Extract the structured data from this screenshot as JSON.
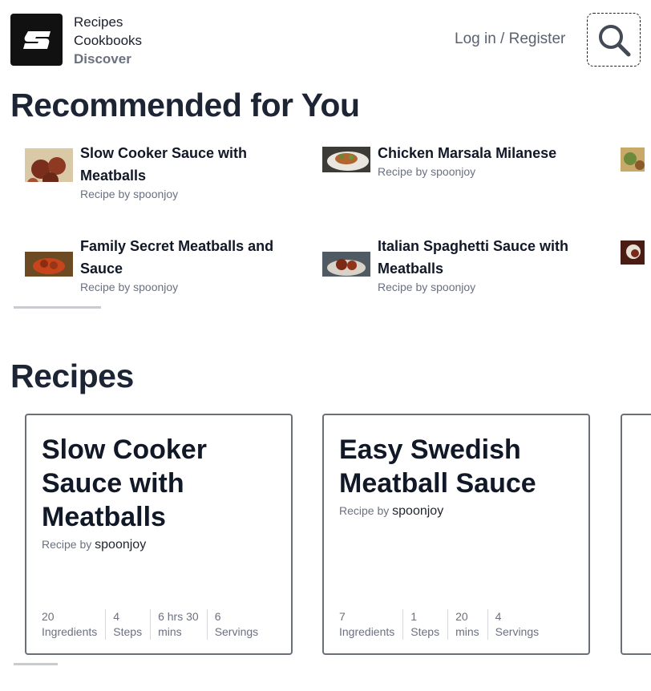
{
  "header": {
    "nav": [
      "Recipes",
      "Cookbooks",
      "Discover"
    ],
    "login_label": "Log in / Register",
    "search_icon": "search-icon"
  },
  "recommended": {
    "title": "Recommended for You",
    "items": [
      {
        "name": "Slow Cooker Sauce with Meatballs",
        "byline": "Recipe by spoonjoy"
      },
      {
        "name": "Chicken Marsala Milanese",
        "byline": "Recipe by spoonjoy"
      },
      {
        "name": "Family Secret Meatballs and Sauce",
        "byline": "Recipe by spoonjoy"
      },
      {
        "name": "Italian Spaghetti Sauce with Meatballs",
        "byline": "Recipe by spoonjoy"
      }
    ]
  },
  "recipes": {
    "title": "Recipes",
    "cards": [
      {
        "title": "Slow Cooker Sauce with Meatballs",
        "by_label": "Recipe by",
        "author": "spoonjoy",
        "stats": [
          {
            "value": "20",
            "label": "Ingredients"
          },
          {
            "value": "4",
            "label": "Steps"
          },
          {
            "value": "6 hrs 30",
            "label": "mins"
          },
          {
            "value": "6",
            "label": "Servings"
          }
        ]
      },
      {
        "title": "Easy Swedish Meatball Sauce",
        "by_label": "Recipe by",
        "author": "spoonjoy",
        "stats": [
          {
            "value": "7",
            "label": "Ingredients"
          },
          {
            "value": "1",
            "label": "Steps"
          },
          {
            "value": "20",
            "label": "mins"
          },
          {
            "value": "4",
            "label": "Servings"
          }
        ]
      }
    ]
  }
}
